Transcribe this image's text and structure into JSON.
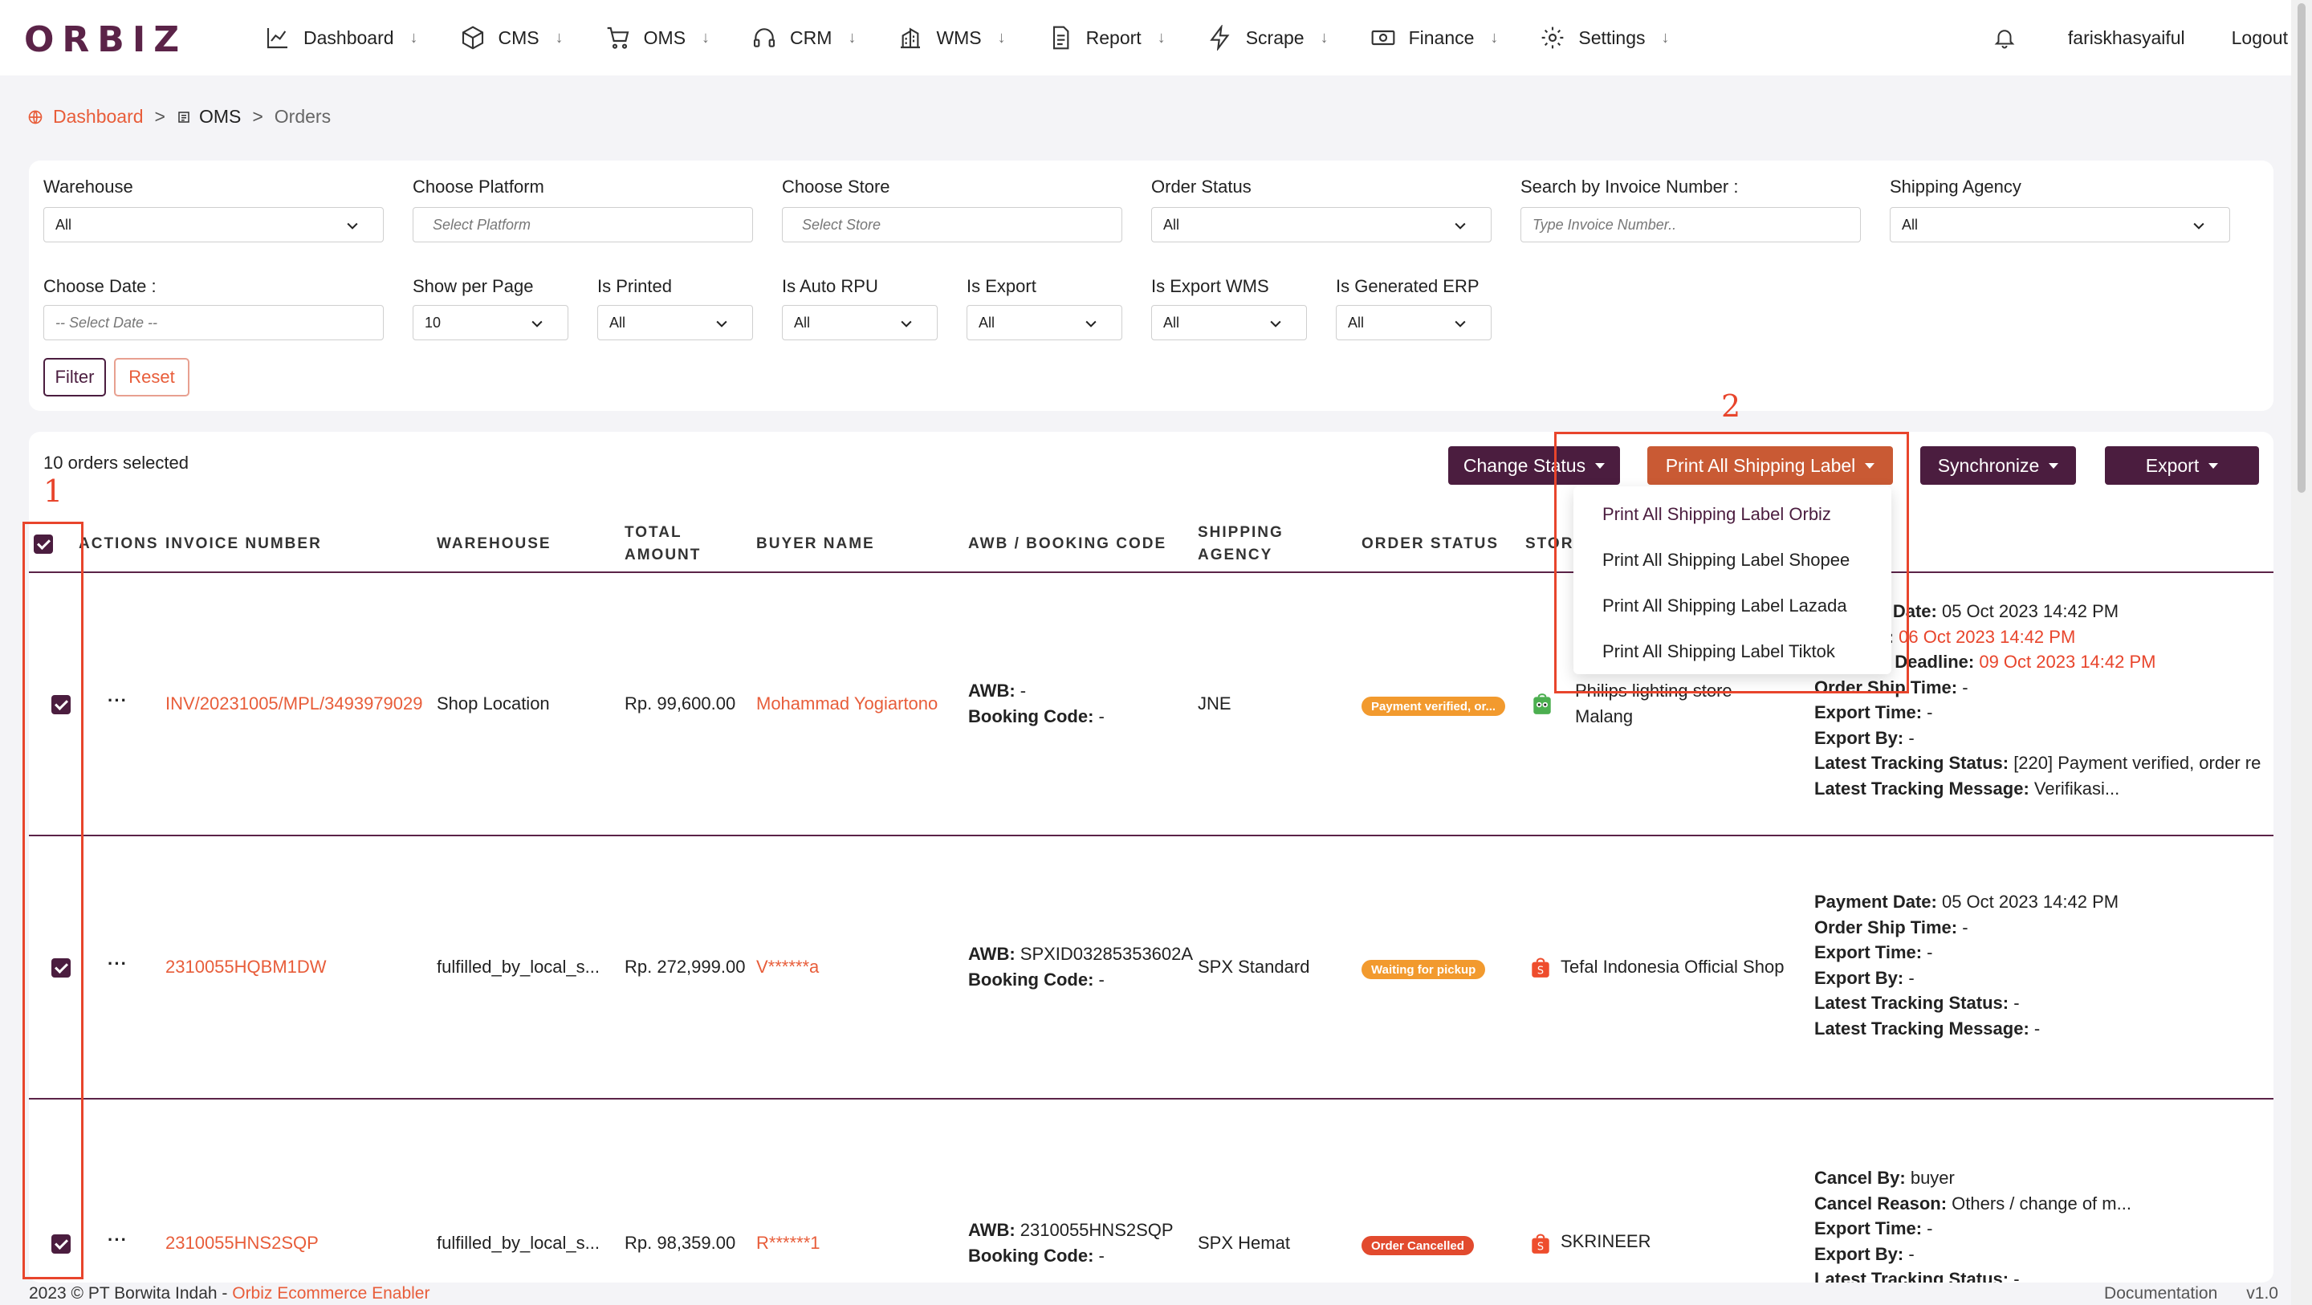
{
  "app": {
    "logo": "ORBIZ"
  },
  "nav": {
    "items": [
      {
        "label": "Dashboard",
        "icon": "chart-line-icon"
      },
      {
        "label": "CMS",
        "icon": "box-icon"
      },
      {
        "label": "OMS",
        "icon": "cart-icon"
      },
      {
        "label": "CRM",
        "icon": "headset-icon"
      },
      {
        "label": "WMS",
        "icon": "warehouse-icon"
      },
      {
        "label": "Report",
        "icon": "document-icon"
      },
      {
        "label": "Scrape",
        "icon": "bolt-icon"
      },
      {
        "label": "Finance",
        "icon": "money-icon"
      },
      {
        "label": "Settings",
        "icon": "gear-icon"
      }
    ],
    "arrow": "↓",
    "username": "fariskhasyaiful",
    "logout": "Logout"
  },
  "breadcrumb": {
    "home": "Dashboard",
    "section": "OMS",
    "current": "Orders",
    "sep": ">"
  },
  "filters": {
    "warehouse": {
      "label": "Warehouse",
      "value": "All"
    },
    "platform": {
      "label": "Choose Platform",
      "placeholder": "Select Platform"
    },
    "store": {
      "label": "Choose Store",
      "placeholder": "Select Store"
    },
    "order_status": {
      "label": "Order Status",
      "value": "All"
    },
    "invoice": {
      "label": "Search by Invoice Number :",
      "placeholder": "Type Invoice Number.."
    },
    "agency": {
      "label": "Shipping Agency",
      "value": "All"
    },
    "date": {
      "label": "Choose Date :",
      "placeholder": "-- Select Date --"
    },
    "per_page": {
      "label": "Show per Page",
      "value": "10"
    },
    "is_printed": {
      "label": "Is Printed",
      "value": "All"
    },
    "is_auto_rpu": {
      "label": "Is Auto RPU",
      "value": "All"
    },
    "is_export": {
      "label": "Is Export",
      "value": "All"
    },
    "is_export_wms": {
      "label": "Is Export WMS",
      "value": "All"
    },
    "is_generated_erp": {
      "label": "Is Generated ERP",
      "value": "All"
    },
    "filter_btn": "Filter",
    "reset_btn": "Reset"
  },
  "toolbar": {
    "selected": "10 orders selected",
    "change_status": "Change Status",
    "print_all": "Print All Shipping Label",
    "synchronize": "Synchronize",
    "export": "Export"
  },
  "dropdown": {
    "items": [
      "Print All Shipping Label Orbiz",
      "Print All Shipping Label Shopee",
      "Print All Shipping Label Lazada",
      "Print All Shipping Label Tiktok"
    ]
  },
  "table": {
    "headers": {
      "actions": "ACTIONS",
      "invoice": "INVOICE NUMBER",
      "warehouse": "WAREHOUSE",
      "total1": "TOTAL",
      "total2": "AMOUNT",
      "buyer": "BUYER NAME",
      "awb": "AWB / BOOKING CODE",
      "agency1": "SHIPPING",
      "agency2": "AGENCY",
      "status": "ORDER STATUS",
      "store": "STOR"
    },
    "rows": [
      {
        "dots": "···",
        "invoice": "INV/20231005/MPL/3493979029",
        "warehouse": "Shop Location",
        "total": "Rp. 99,600.00",
        "buyer": "Mohammad Yogiartono",
        "awb_label": "AWB:",
        "awb": " -",
        "booking_label": "Booking Code:",
        "booking": " -",
        "agency": "JNE",
        "status": "Payment verified, or...",
        "status_color": "#f29a2e",
        "store_line1": "Philips lighting store",
        "store_line2": "Malang",
        "details": [
          {
            "label": "Payment Date:",
            "value": " 05 Oct 2023 14:42 PM",
            "red": false
          },
          {
            "label": "Deadline:",
            "value": " 06 Oct 2023 14:42 PM",
            "red": true
          },
          {
            "label": "Shipping Deadline:",
            "value": " 09 Oct 2023 14:42 PM",
            "red": true
          },
          {
            "label": "Order Ship Time:",
            "value": " -",
            "red": false
          },
          {
            "label": "Export Time:",
            "value": " -",
            "red": false
          },
          {
            "label": "Export By:",
            "value": " -",
            "red": false
          },
          {
            "label": "Latest Tracking Status:",
            "value": " [220] Payment verified, order re",
            "red": false
          },
          {
            "label": "Latest Tracking Message:",
            "value": " Verifikasi...",
            "red": false
          }
        ]
      },
      {
        "dots": "···",
        "invoice": "2310055HQBM1DW",
        "warehouse": "fulfilled_by_local_s...",
        "total": "Rp. 272,999.00",
        "buyer": "V******a",
        "awb_label": "AWB:",
        "awb": " SPXID03285353602A",
        "booking_label": "Booking Code:",
        "booking": " -",
        "agency": "SPX Standard",
        "status": "Waiting for pickup",
        "status_color": "#f29a2e",
        "store_line1": "Tefal Indonesia Official Shop",
        "store_line2": "",
        "details": [
          {
            "label": "Payment Date:",
            "value": " 05 Oct 2023 14:42 PM",
            "red": false
          },
          {
            "label": "Order Ship Time:",
            "value": " -",
            "red": false
          },
          {
            "label": "Export Time:",
            "value": " -",
            "red": false
          },
          {
            "label": "Export By:",
            "value": " -",
            "red": false
          },
          {
            "label": "Latest Tracking Status:",
            "value": " -",
            "red": false
          },
          {
            "label": "Latest Tracking Message:",
            "value": " -",
            "red": false
          }
        ]
      },
      {
        "dots": "···",
        "invoice": "2310055HNS2SQP",
        "warehouse": "fulfilled_by_local_s...",
        "total": "Rp. 98,359.00",
        "buyer": "R******1",
        "awb_label": "AWB:",
        "awb": " 2310055HNS2SQP",
        "booking_label": "Booking Code:",
        "booking": " -",
        "agency": "SPX Hemat",
        "status": "Order Cancelled",
        "status_color": "#e24a2e",
        "store_line1": "SKRINEER",
        "store_line2": "",
        "details": [
          {
            "label": "Cancel By:",
            "value": " buyer",
            "red": false
          },
          {
            "label": "Cancel Reason:",
            "value": " Others / change of m...",
            "red": false
          },
          {
            "label": "Export Time:",
            "value": " -",
            "red": false
          },
          {
            "label": "Export By:",
            "value": " -",
            "red": false
          },
          {
            "label": "Latest Tracking Status:",
            "value": " -",
            "red": false
          }
        ]
      }
    ]
  },
  "annotations": {
    "one": "1",
    "two": "2"
  },
  "footer": {
    "copyright": "2023 © PT Borwita Indah - ",
    "link": "Orbiz Ecommerce Enabler",
    "documentation": "Documentation",
    "version": "v1.0"
  },
  "colors": {
    "brand": "#4b1d3f",
    "accent": "#e85d3a",
    "print_btn": "#c95a34"
  }
}
